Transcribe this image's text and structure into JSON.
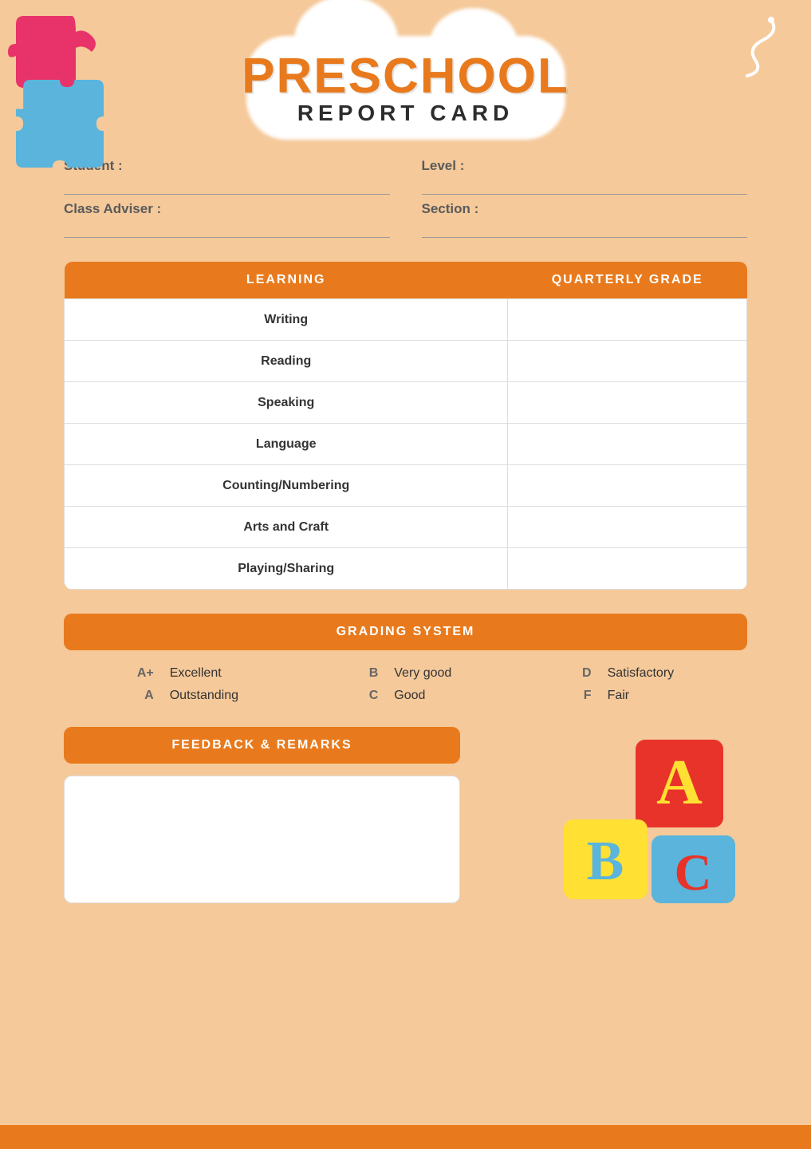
{
  "header": {
    "title_preschool": "PRESCHOOL",
    "title_report": "REPORT CARD"
  },
  "student_info": {
    "student_label": "Student :",
    "student_value": "",
    "level_label": "Level :",
    "level_value": "",
    "adviser_label": "Class Adviser :",
    "adviser_value": "",
    "section_label": "Section :",
    "section_value": ""
  },
  "learning_table": {
    "col1_header": "LEARNING",
    "col2_header": "QUARTERLY GRADE",
    "rows": [
      {
        "subject": "Writing",
        "grade": ""
      },
      {
        "subject": "Reading",
        "grade": ""
      },
      {
        "subject": "Speaking",
        "grade": ""
      },
      {
        "subject": "Language",
        "grade": ""
      },
      {
        "subject": "Counting/Numbering",
        "grade": ""
      },
      {
        "subject": "Arts and Craft",
        "grade": ""
      },
      {
        "subject": "Playing/Sharing",
        "grade": ""
      }
    ]
  },
  "grading_system": {
    "header": "GRADING SYSTEM",
    "entries": [
      {
        "letter": "A+",
        "description": "Excellent"
      },
      {
        "letter": "B",
        "description": "Very good"
      },
      {
        "letter": "D",
        "description": "Satisfactory"
      },
      {
        "letter": "A",
        "description": "Outstanding"
      },
      {
        "letter": "C",
        "description": "Good"
      },
      {
        "letter": "F",
        "description": "Fair"
      }
    ]
  },
  "feedback": {
    "header": "FEEDBACK & REMARKS",
    "placeholder": ""
  }
}
